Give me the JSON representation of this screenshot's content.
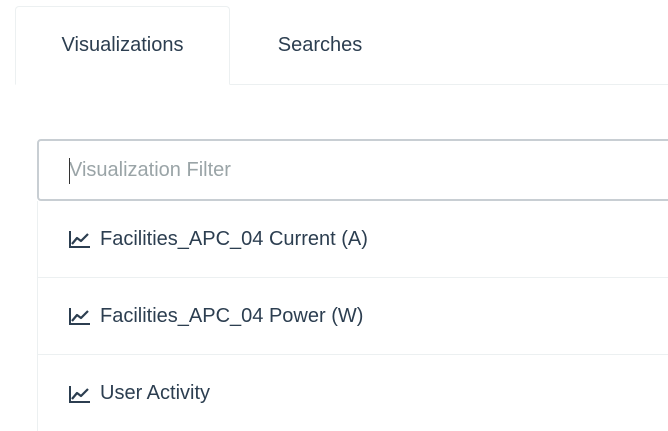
{
  "tabs": [
    {
      "label": "Visualizations",
      "active": true
    },
    {
      "label": "Searches",
      "active": false
    }
  ],
  "filter": {
    "placeholder": "Visualization Filter",
    "value": ""
  },
  "items": [
    {
      "icon": "line-chart-icon",
      "label": "Facilities_APC_04 Current (A)"
    },
    {
      "icon": "line-chart-icon",
      "label": "Facilities_APC_04 Power (W)"
    },
    {
      "icon": "line-chart-icon",
      "label": "User Activity"
    }
  ],
  "colors": {
    "text": "#2c3e50",
    "placeholder": "#9aa4a7",
    "border": "#ecf0f1",
    "input_border": "#c8ced3"
  }
}
